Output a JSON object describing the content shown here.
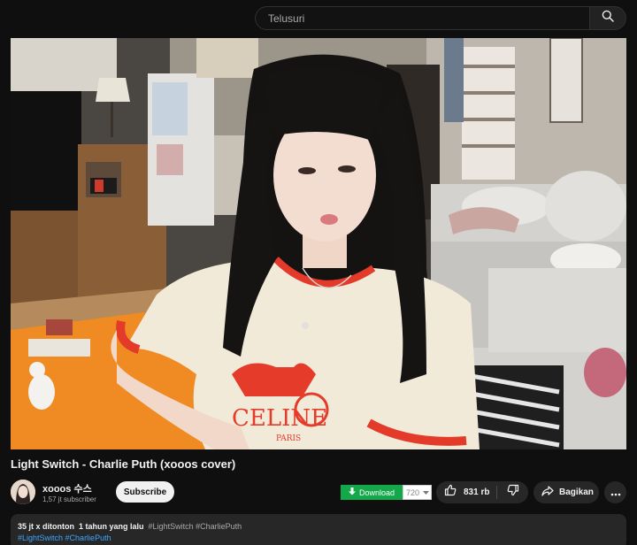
{
  "search": {
    "placeholder": "Telusuri"
  },
  "video": {
    "title": "Light Switch - Charlie Puth (xooos cover)",
    "shirt_logo_text": "CELINE",
    "shirt_logo_subtext": "PARIS"
  },
  "channel": {
    "name": "xooos 수스",
    "subscribers": "1,57 jt subscriber",
    "subscribe_label": "Subscribe"
  },
  "download": {
    "label": "Download",
    "quality": "720",
    "color": "#13a84a"
  },
  "actions": {
    "like_count": "831 rb",
    "share_label": "Bagikan"
  },
  "description": {
    "views": "35 jt x ditonton",
    "age": "1 tahun yang lalu",
    "inline_tags": "#LightSwitch #CharliePuth",
    "tags_line": [
      "#LightSwitch",
      "#CharliePuth"
    ]
  },
  "icons": {
    "search": "search-icon",
    "download": "download-arrow-icon",
    "dropdown": "chevron-down-icon",
    "like": "thumbs-up-icon",
    "dislike": "thumbs-down-icon",
    "share": "share-arrow-icon",
    "more": "more-horizontal-icon"
  },
  "colors": {
    "background": "#0f0f0f",
    "pill": "#272727",
    "link": "#3ea6ff"
  }
}
